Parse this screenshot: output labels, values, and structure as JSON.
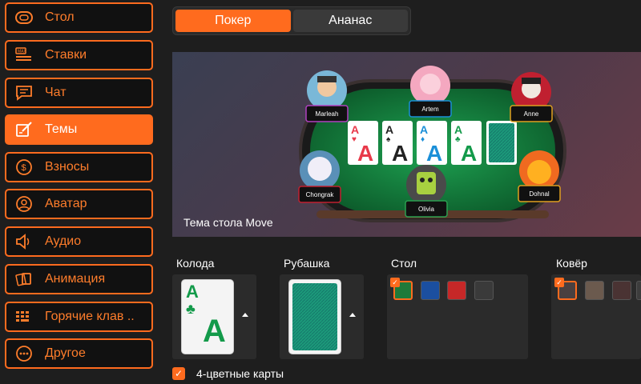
{
  "sidebar": {
    "items": [
      {
        "label": "Стол",
        "icon": "table-icon"
      },
      {
        "label": "Ставки",
        "icon": "bets-icon"
      },
      {
        "label": "Чат",
        "icon": "chat-icon"
      },
      {
        "label": "Темы",
        "icon": "themes-icon",
        "active": true
      },
      {
        "label": "Взносы",
        "icon": "coin-icon"
      },
      {
        "label": "Аватар",
        "icon": "avatar-icon"
      },
      {
        "label": "Аудио",
        "icon": "speaker-icon"
      },
      {
        "label": "Анимация",
        "icon": "animation-icon"
      },
      {
        "label": "Горячие клав ..",
        "icon": "keyboard-icon"
      },
      {
        "label": "Другое",
        "icon": "more-icon"
      }
    ]
  },
  "tabs": [
    {
      "label": "Покер",
      "active": true
    },
    {
      "label": "Ананас",
      "active": false
    }
  ],
  "preview": {
    "caption": "Тема стола Move",
    "players": [
      "Marleah",
      "Artem",
      "Anne",
      "Chongrak",
      "Olivia",
      "Dohnal"
    ],
    "board_cards": [
      "A♥",
      "A♠",
      "A♦",
      "A♣"
    ]
  },
  "sections": {
    "deck": {
      "label": "Колода",
      "card_rank": "A",
      "card_suit": "♣"
    },
    "back": {
      "label": "Рубашка"
    },
    "table": {
      "label": "Стол",
      "colors": [
        "#1f7a3a",
        "#1b4fa0",
        "#c62828",
        "#3a3a3a"
      ],
      "selected": 0
    },
    "carpet": {
      "label": "Ковёр",
      "colors": [
        "#4a4040",
        "#6b5a4e",
        "#4a3333",
        "#3d3d3d"
      ],
      "selected": 0
    }
  },
  "four_color": {
    "label": "4-цветные карты",
    "checked": true
  },
  "colors": {
    "accent": "#ff6b1e",
    "felt": "#137a3e",
    "background": "#1e1e1e"
  }
}
